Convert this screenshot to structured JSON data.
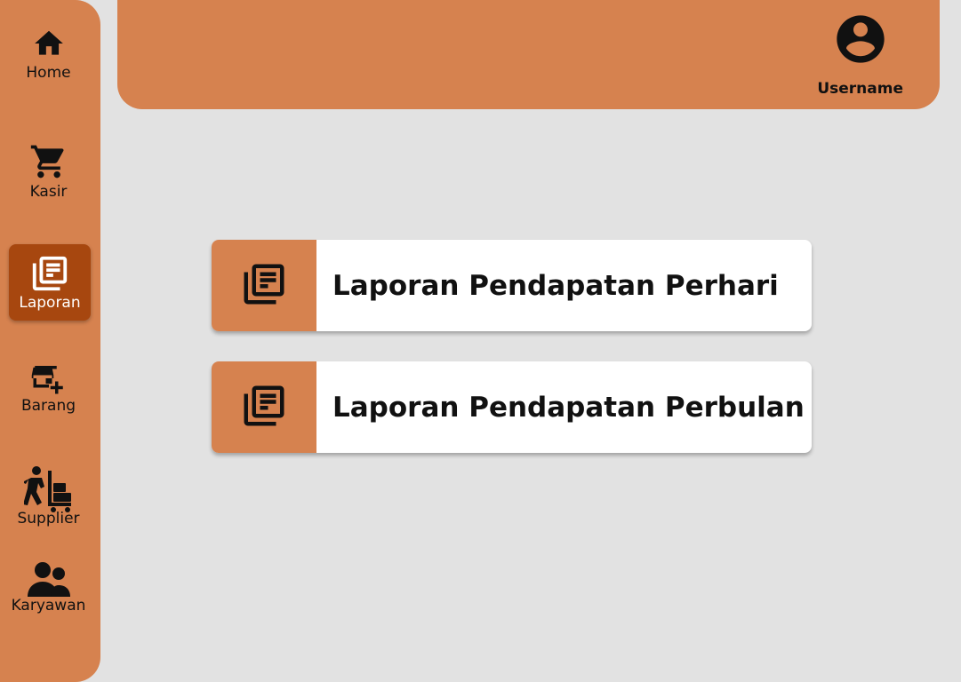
{
  "sidebar": {
    "items": [
      {
        "label": "Home",
        "icon": "home-icon"
      },
      {
        "label": "Kasir",
        "icon": "cart-icon"
      },
      {
        "label": "Laporan",
        "icon": "report-icon",
        "active": true
      },
      {
        "label": "Barang",
        "icon": "store-add-icon"
      },
      {
        "label": "Supplier",
        "icon": "dolly-icon"
      },
      {
        "label": "Karyawan",
        "icon": "people-icon"
      }
    ]
  },
  "header": {
    "user": {
      "label": "Username",
      "icon": "account-circle-icon"
    }
  },
  "reports": [
    {
      "title": "Laporan Pendapatan Perhari",
      "icon": "report-icon"
    },
    {
      "title": "Laporan Pendapatan Perbulan",
      "icon": "report-icon"
    }
  ],
  "colors": {
    "accent": "#d6824f",
    "active": "#a7470f",
    "background": "#e2e2e2",
    "card": "#ffffff"
  }
}
